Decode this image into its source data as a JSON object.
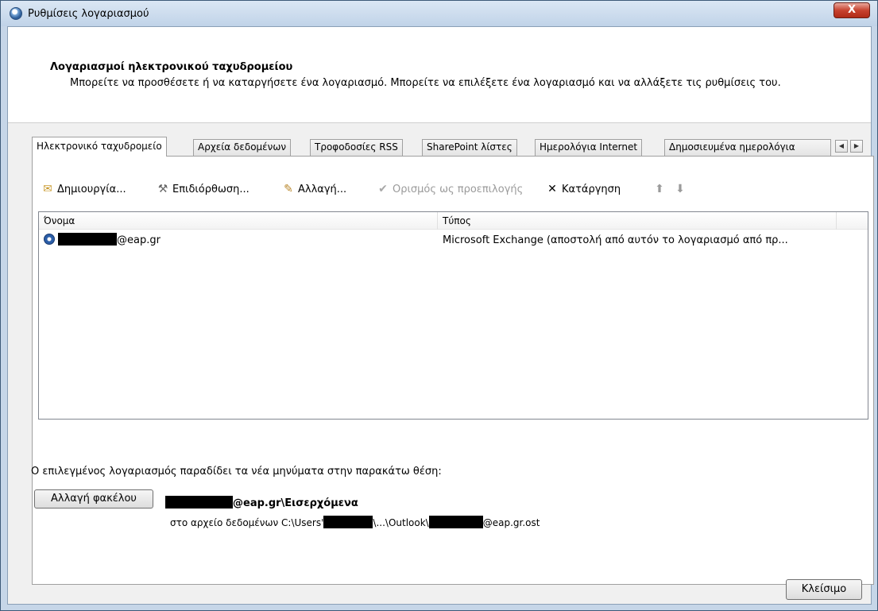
{
  "window": {
    "title": "Ρυθμίσεις λογαριασμού",
    "close_label": "X"
  },
  "header": {
    "title": "Λογαριασμοί ηλεκτρονικού ταχυδρομείου",
    "description": "Μπορείτε να προσθέσετε ή να καταργήσετε ένα λογαριασμό. Μπορείτε να επιλέξετε ένα λογαριασμό και να αλλάξετε τις ρυθμίσεις του."
  },
  "tabs": [
    {
      "label": "Ηλεκτρονικό ταχυδρομείο",
      "active": true
    },
    {
      "label": "Αρχεία δεδομένων"
    },
    {
      "label": "Τροφοδοσίες RSS"
    },
    {
      "label": "SharePoint λίστες"
    },
    {
      "label": "Ημερολόγια Internet"
    },
    {
      "label": "Δημοσιευμένα ημερολόγια"
    }
  ],
  "toolbar": {
    "new_label": "Δημιουργία...",
    "repair_label": "Επιδιόρθωση...",
    "change_label": "Αλλαγή...",
    "set_default_label": "Ορισμός ως προεπιλογής",
    "remove_label": "Κατάργηση"
  },
  "list": {
    "columns": [
      "Όνομα",
      "Τύπος"
    ],
    "rows": [
      {
        "name_suffix": "@eap.gr",
        "type": "Microsoft Exchange (αποστολή από αυτόν το λογαριασμό από πρ..."
      }
    ]
  },
  "delivery": {
    "label": "Ο επιλεγμένος λογαριασμός παραδίδει τα νέα μηνύματα στην παρακάτω θέση:",
    "change_folder_label": "Αλλαγή φακέλου",
    "folder_suffix": "@eap.gr\\Εισερχόμενα",
    "file_prefix": "στο αρχείο δεδομένων C:\\Users'",
    "file_middle": "\\...\\Outlook\\",
    "file_suffix": "@eap.gr.ost"
  },
  "footer": {
    "close_label": "Κλείσιμο"
  }
}
